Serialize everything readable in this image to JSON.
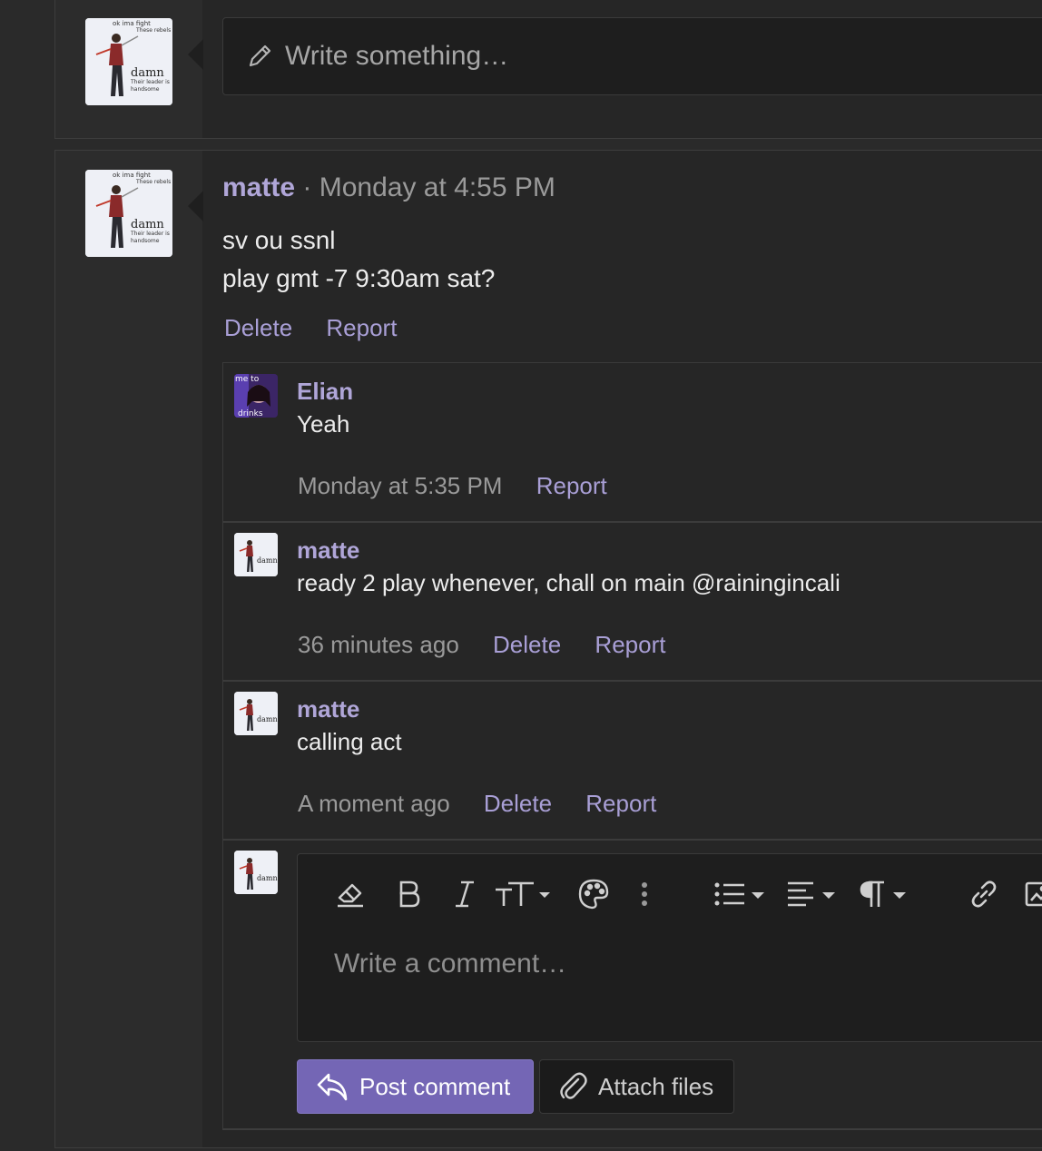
{
  "composer": {
    "placeholder": "Write something…",
    "avatar_caption": [
      "ok ima fight",
      "These rebels",
      "damn",
      "Their leader is",
      "handsome"
    ]
  },
  "post": {
    "author": "matte",
    "separator": "·",
    "time": "Monday at 4:55 PM",
    "lines": [
      "sv ou ssnl",
      "play gmt -7 9:30am sat?"
    ],
    "delete_label": "Delete",
    "report_label": "Report"
  },
  "comments": [
    {
      "author": "Elian",
      "text": "Yeah",
      "time": "Monday at 5:35 PM",
      "report_label": "Report",
      "avatar_caption": [
        "me to",
        "drinks"
      ]
    },
    {
      "author": "matte",
      "text": "ready 2 play whenever, chall on main @rainingincali",
      "time": "36 minutes ago",
      "delete_label": "Delete",
      "report_label": "Report"
    },
    {
      "author": "matte",
      "text": "calling act",
      "time": "A moment ago",
      "delete_label": "Delete",
      "report_label": "Report"
    }
  ],
  "editor": {
    "placeholder": "Write a comment…",
    "toolbar": [
      "eraser-icon",
      "bold-icon",
      "italic-icon",
      "text-size-icon",
      "palette-icon",
      "more-icon",
      "list-icon",
      "align-icon",
      "paragraph-icon",
      "link-icon",
      "image-icon"
    ]
  },
  "buttons": {
    "post_comment": "Post comment",
    "attach_files": "Attach files"
  },
  "colors": {
    "accent": "#7466b5",
    "link": "#a99fd6",
    "author": "#b0a6d8",
    "background": "#2a2a2a"
  }
}
